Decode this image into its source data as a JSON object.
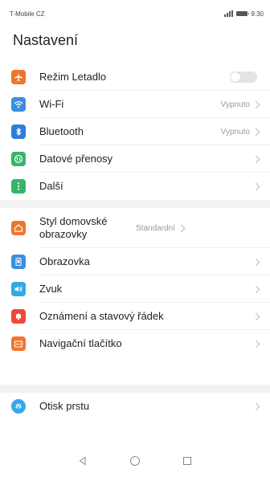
{
  "status_bar": {
    "carrier": "T-Mobile CZ",
    "time": "9:30"
  },
  "page_title": "Nastavení",
  "colors": {
    "airplane": "#f0752c",
    "wifi": "#3a8ee0",
    "bluetooth": "#2e7ed8",
    "data": "#35b56a",
    "more": "#35b56a",
    "home_style": "#f0752c",
    "display": "#3a8ee0",
    "sound": "#35a9e6",
    "notifications": "#e84b3c",
    "nav_key": "#f0752c",
    "fingerprint": "#35a9e6"
  },
  "settings": {
    "group1": [
      {
        "id": "airplane",
        "icon": "airplane-icon",
        "label": "Režim Letadlo",
        "control": "toggle",
        "toggle_on": false
      },
      {
        "id": "wifi",
        "icon": "wifi-icon",
        "label": "Wi-Fi",
        "value": "Vypnuto"
      },
      {
        "id": "bluetooth",
        "icon": "bluetooth-icon",
        "label": "Bluetooth",
        "value": "Vypnuto"
      },
      {
        "id": "data",
        "icon": "data-transfer-icon",
        "label": "Datové přenosy"
      },
      {
        "id": "more",
        "icon": "more-icon",
        "label": "Další"
      }
    ],
    "group2": [
      {
        "id": "home_style",
        "icon": "home-icon",
        "label": "Styl domovské obrazovky",
        "value": "Standardní"
      },
      {
        "id": "display",
        "icon": "display-icon",
        "label": "Obrazovka"
      },
      {
        "id": "sound",
        "icon": "sound-icon",
        "label": "Zvuk"
      },
      {
        "id": "notifications",
        "icon": "notification-icon",
        "label": "Oznámení a stavový řádek"
      },
      {
        "id": "nav_key",
        "icon": "navigation-key-icon",
        "label": "Navigační tlačítko"
      }
    ],
    "group3": [
      {
        "id": "fingerprint",
        "icon": "fingerprint-icon",
        "label": "Otisk prstu"
      }
    ]
  },
  "nav_bar": {
    "back": "back-icon",
    "home": "home-circle-icon",
    "recents": "recents-icon"
  }
}
